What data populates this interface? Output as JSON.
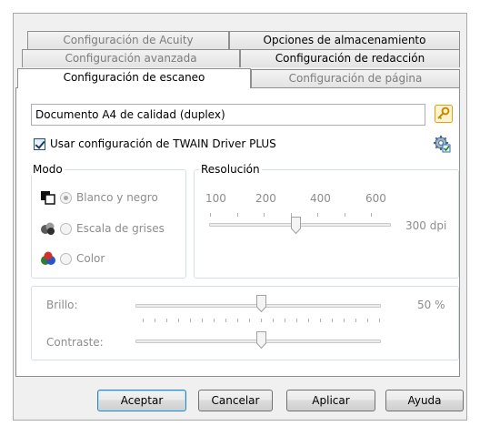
{
  "tabs": {
    "row1": [
      {
        "label": "Configuración de Acuity",
        "state": "inactive"
      },
      {
        "label": "Opciones de almacenamiento",
        "state": "active"
      }
    ],
    "row2": [
      {
        "label": "Configuración avanzada",
        "state": "inactive"
      },
      {
        "label": "Configuración de redacción",
        "state": "active"
      }
    ],
    "row3": [
      {
        "label": "Configuración de escaneo",
        "state": "selected"
      },
      {
        "label": "Configuración de página",
        "state": "inactive"
      }
    ]
  },
  "profile": {
    "name": "Documento A4 de calidad (duplex)",
    "edit_icon": "key-icon"
  },
  "twain": {
    "label": "Usar configuración de TWAIN Driver PLUS",
    "checked": true,
    "settings_icon": "gear-settings-icon"
  },
  "mode": {
    "title": "Modo",
    "options": [
      {
        "label": "Blanco y negro",
        "icon": "black-white-icon",
        "selected": true
      },
      {
        "label": "Escala de grises",
        "icon": "grayscale-icon",
        "selected": false
      },
      {
        "label": "Color",
        "icon": "color-icon",
        "selected": false
      }
    ]
  },
  "resolution": {
    "title": "Resolución",
    "scale_labels": [
      "100",
      "200",
      "400",
      "600"
    ],
    "value_label": "300 dpi",
    "value": 300
  },
  "adjustments": {
    "brightness_label": "Brillo:",
    "brightness_value_label": "50 %",
    "brightness_value": 50,
    "contrast_label": "Contraste:",
    "contrast_value": 50
  },
  "buttons": {
    "accept": "Aceptar",
    "cancel": "Cancelar",
    "apply": "Aplicar",
    "help": "Ayuda"
  },
  "colors": {
    "panel_border": "#8e8f8f",
    "disabled_text": "#8d8d8d",
    "default_button_border": "#3c7fb1"
  }
}
